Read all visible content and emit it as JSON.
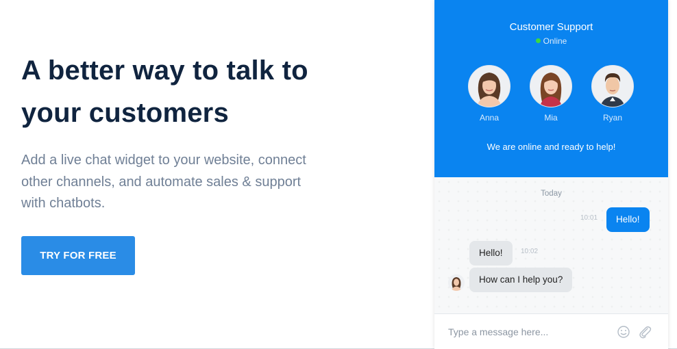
{
  "hero": {
    "headline_line1": "A better way to talk to",
    "headline_line2": "your customers",
    "subtext_line1": "Add a live chat widget to your website, connect",
    "subtext_line2": "other channels, and automate sales & support",
    "subtext_line3": "with chatbots.",
    "cta_label": "TRY FOR FREE"
  },
  "widget": {
    "title": "Customer Support",
    "status": "Online",
    "agents": [
      {
        "name": "Anna"
      },
      {
        "name": "Mia"
      },
      {
        "name": "Ryan"
      }
    ],
    "online_message": "We are online and ready to help!",
    "day_label": "Today",
    "messages": [
      {
        "text": "Hello!",
        "time": "10:01",
        "from": "visitor"
      },
      {
        "text": "Hello!",
        "time": "10:02",
        "from": "agent"
      },
      {
        "text": "How can I help you?",
        "from": "agent"
      }
    ],
    "composer_placeholder": "Type a message here...",
    "icons": {
      "emoji": "smiley-icon",
      "attach": "paperclip-icon"
    }
  },
  "colors": {
    "accent": "#0a84f0",
    "cta": "#2a8ce6",
    "headline": "#10243f",
    "subtext": "#6f7f95",
    "online_dot": "#3fd83f"
  }
}
